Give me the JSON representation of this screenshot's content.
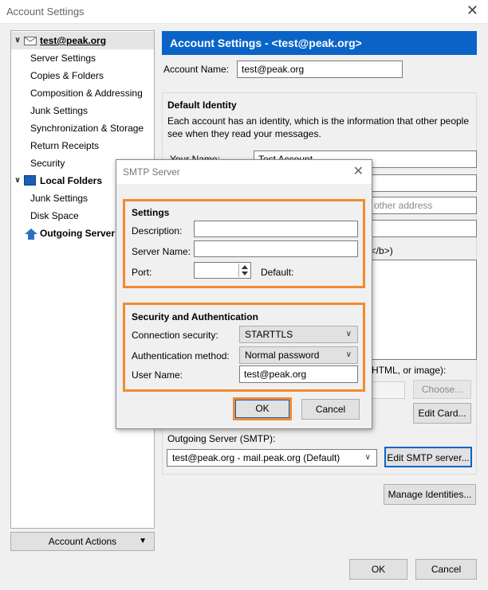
{
  "window": {
    "title": "Account Settings",
    "close": "✕"
  },
  "sidebar": {
    "account": "test@peak.org",
    "items": [
      "Server Settings",
      "Copies & Folders",
      "Composition & Addressing",
      "Junk Settings",
      "Synchronization & Storage",
      "Return Receipts",
      "Security"
    ],
    "local_folders": "Local Folders",
    "local_items": [
      "Junk Settings",
      "Disk Space"
    ],
    "outgoing": "Outgoing Server (SMTP)",
    "account_actions": "Account Actions"
  },
  "main": {
    "header": "Account Settings - <test@peak.org>",
    "account_name_label": "Account Name:",
    "account_name_value": "test@peak.org",
    "default_identity_title": "Default Identity",
    "default_identity_desc_1": "Each account has an identity, which is the information that other people",
    "default_identity_desc_2": "see when they read your messages.",
    "your_name_label": "Your Name:",
    "your_name_value": "Test Account",
    "reply_placeholder": "other address",
    "sig_fragment": "d</b>)",
    "attach_fragment": "HTML, or image):",
    "choose_btn": "Choose...",
    "edit_card_btn": "Edit Card...",
    "outgoing_label": "Outgoing Server (SMTP):",
    "outgoing_value": "test@peak.org - mail.peak.org (Default)",
    "edit_smtp_btn": "Edit SMTP server...",
    "manage_identities_btn": "Manage Identities...",
    "ok_btn": "OK",
    "cancel_btn": "Cancel"
  },
  "dialog": {
    "title": "SMTP Server",
    "close": "✕",
    "settings_title": "Settings",
    "description_label": "Description:",
    "server_name_label": "Server Name:",
    "port_label": "Port:",
    "default_label": "Default:",
    "security_title": "Security and Authentication",
    "conn_security_label": "Connection security:",
    "conn_security_value": "STARTTLS",
    "auth_method_label": "Authentication method:",
    "auth_method_value": "Normal password",
    "user_name_label": "User Name:",
    "user_name_value": "test@peak.org",
    "ok_btn": "OK",
    "cancel_btn": "Cancel"
  },
  "colors": {
    "header_blue": "#0a64c8",
    "highlight": "#f28a30"
  }
}
